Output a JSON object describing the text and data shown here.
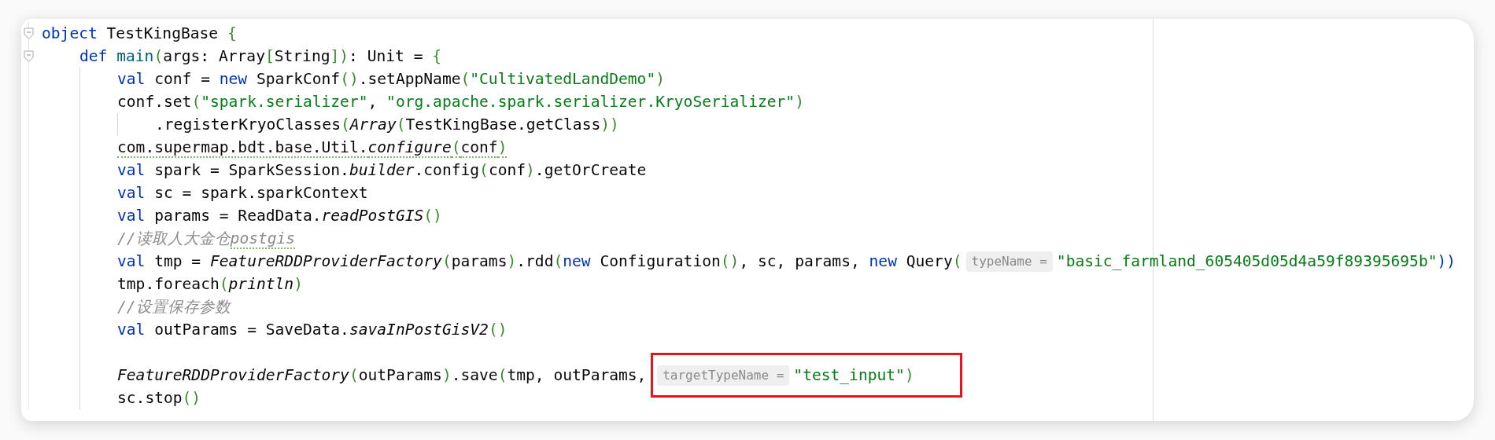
{
  "editor": {
    "lines": [
      {
        "kind": "code",
        "fold_marker": true,
        "tokens": [
          {
            "kind": "kw",
            "text": "object"
          },
          {
            "kind": "plain",
            "text": " TestKingBase "
          },
          {
            "kind": "punct",
            "text": "{"
          }
        ],
        "children": [
          {
            "kind": "code",
            "fold_marker": true,
            "tokens": [
              {
                "kind": "kw",
                "text": "def"
              },
              {
                "kind": "fn",
                "text": " main"
              },
              {
                "kind": "punct",
                "text": "("
              },
              {
                "kind": "plain",
                "text": "args: Array"
              },
              {
                "kind": "punct",
                "text": "["
              },
              {
                "kind": "plain",
                "text": "String"
              },
              {
                "kind": "punct",
                "text": "])"
              },
              {
                "kind": "plain",
                "text": ": Unit = "
              },
              {
                "kind": "punct",
                "text": "{"
              }
            ],
            "children": [
              {
                "kind": "code",
                "tokens": [
                  {
                    "kind": "kw",
                    "text": "val"
                  },
                  {
                    "kind": "plain",
                    "text": " conf = "
                  },
                  {
                    "kind": "kw",
                    "text": "new"
                  },
                  {
                    "kind": "plain",
                    "text": " SparkConf"
                  },
                  {
                    "kind": "punct",
                    "text": "()"
                  },
                  {
                    "kind": "plain",
                    "text": ".setAppName"
                  },
                  {
                    "kind": "punct",
                    "text": "("
                  },
                  {
                    "kind": "str",
                    "text": "\"CultivatedLandDemo\""
                  },
                  {
                    "kind": "punct",
                    "text": ")"
                  }
                ]
              },
              {
                "kind": "code",
                "tokens": [
                  {
                    "kind": "plain",
                    "text": "conf.set"
                  },
                  {
                    "kind": "punct",
                    "text": "("
                  },
                  {
                    "kind": "str",
                    "text": "\"spark.serializer\""
                  },
                  {
                    "kind": "plain",
                    "text": ", "
                  },
                  {
                    "kind": "str",
                    "text": "\"org.apache.spark.serializer.KryoSerializer\""
                  },
                  {
                    "kind": "punct",
                    "text": ")"
                  }
                ],
                "children": [
                  {
                    "kind": "code",
                    "tokens": [
                      {
                        "kind": "plain",
                        "text": ".registerKryoClasses"
                      },
                      {
                        "kind": "punct",
                        "text": "("
                      },
                      {
                        "kind": "italic",
                        "text": "Array"
                      },
                      {
                        "kind": "punct",
                        "text": "("
                      },
                      {
                        "kind": "plain",
                        "text": "TestKingBase.getClass"
                      },
                      {
                        "kind": "punct",
                        "text": "))"
                      }
                    ]
                  }
                ]
              },
              {
                "kind": "code",
                "tokens": [
                  {
                    "kind": "plain",
                    "text": "com.supermap.bdt.base.Util.",
                    "warning": true
                  },
                  {
                    "kind": "italic",
                    "text": "configure",
                    "warning": true
                  },
                  {
                    "kind": "punct",
                    "text": "(",
                    "warning": true
                  },
                  {
                    "kind": "plain",
                    "text": "conf",
                    "warning": true
                  },
                  {
                    "kind": "punct",
                    "text": ")",
                    "warning": true
                  }
                ]
              },
              {
                "kind": "code",
                "tokens": [
                  {
                    "kind": "kw",
                    "text": "val"
                  },
                  {
                    "kind": "plain",
                    "text": " spark = SparkSession."
                  },
                  {
                    "kind": "italic",
                    "text": "builder"
                  },
                  {
                    "kind": "plain",
                    "text": ".config"
                  },
                  {
                    "kind": "punct",
                    "text": "("
                  },
                  {
                    "kind": "plain",
                    "text": "conf"
                  },
                  {
                    "kind": "punct",
                    "text": ")"
                  },
                  {
                    "kind": "plain",
                    "text": ".getOrCreate"
                  }
                ]
              },
              {
                "kind": "code",
                "tokens": [
                  {
                    "kind": "kw",
                    "text": "val"
                  },
                  {
                    "kind": "plain",
                    "text": " sc = spark.sparkContext"
                  }
                ]
              },
              {
                "kind": "code",
                "tokens": [
                  {
                    "kind": "kw",
                    "text": "val"
                  },
                  {
                    "kind": "plain",
                    "text": " params = ReadData."
                  },
                  {
                    "kind": "italic",
                    "text": "readPostGIS"
                  },
                  {
                    "kind": "punct",
                    "text": "()"
                  }
                ]
              },
              {
                "kind": "code",
                "tokens": [
                  {
                    "kind": "comment",
                    "text": "//读取人大金仓"
                  },
                  {
                    "kind": "comment",
                    "text": "postgis",
                    "warning": true
                  }
                ]
              },
              {
                "kind": "code",
                "tokens": [
                  {
                    "kind": "kw",
                    "text": "val"
                  },
                  {
                    "kind": "plain",
                    "text": " tmp = "
                  },
                  {
                    "kind": "italic",
                    "text": "FeatureRDDProviderFactory"
                  },
                  {
                    "kind": "punct",
                    "text": "("
                  },
                  {
                    "kind": "plain",
                    "text": "params"
                  },
                  {
                    "kind": "punct",
                    "text": ")"
                  },
                  {
                    "kind": "plain",
                    "text": ".rdd"
                  },
                  {
                    "kind": "punct",
                    "text": "("
                  },
                  {
                    "kind": "kw",
                    "text": "new"
                  },
                  {
                    "kind": "plain",
                    "text": " Configuration"
                  },
                  {
                    "kind": "punct",
                    "text": "()"
                  },
                  {
                    "kind": "plain",
                    "text": ", sc, params, "
                  },
                  {
                    "kind": "kw",
                    "text": "new"
                  },
                  {
                    "kind": "plain",
                    "text": " Query"
                  },
                  {
                    "kind": "punct",
                    "text": "("
                  },
                  {
                    "kind": "hint",
                    "text": "typeName ="
                  },
                  {
                    "kind": "str",
                    "text": "\"basic_farmland_605405d05d4a59f89395695b\""
                  },
                  {
                    "kind": "kwp",
                    "text": "))"
                  }
                ]
              },
              {
                "kind": "code",
                "tokens": [
                  {
                    "kind": "plain",
                    "text": "tmp.foreach"
                  },
                  {
                    "kind": "punct",
                    "text": "("
                  },
                  {
                    "kind": "italic",
                    "text": "println"
                  },
                  {
                    "kind": "punct",
                    "text": ")"
                  }
                ]
              },
              {
                "kind": "code",
                "tokens": [
                  {
                    "kind": "comment",
                    "text": "//设置保存参数"
                  }
                ]
              },
              {
                "kind": "code",
                "tokens": [
                  {
                    "kind": "kw",
                    "text": "val"
                  },
                  {
                    "kind": "plain",
                    "text": " outParams = SaveData."
                  },
                  {
                    "kind": "italic",
                    "text": "savaInPostGisV2"
                  },
                  {
                    "kind": "punct",
                    "text": "()"
                  }
                ]
              },
              {
                "kind": "blank"
              },
              {
                "kind": "code",
                "tokens": [
                  {
                    "kind": "italic",
                    "text": "FeatureRDDProviderFactory"
                  },
                  {
                    "kind": "punct",
                    "text": "("
                  },
                  {
                    "kind": "plain",
                    "text": "outParams"
                  },
                  {
                    "kind": "punct",
                    "text": ")"
                  },
                  {
                    "kind": "plain",
                    "text": ".save"
                  },
                  {
                    "kind": "punct",
                    "text": "("
                  },
                  {
                    "kind": "plain",
                    "text": "tmp, outParams, "
                  },
                  {
                    "kind": "hint",
                    "text": "targetTypeName =",
                    "boxed": true
                  },
                  {
                    "kind": "str",
                    "text": "\"test_input\"",
                    "boxed": true
                  },
                  {
                    "kind": "punct",
                    "text": ")",
                    "boxed": true
                  }
                ]
              },
              {
                "kind": "code",
                "tokens": [
                  {
                    "kind": "plain",
                    "text": "sc.stop"
                  },
                  {
                    "kind": "punct",
                    "text": "()"
                  }
                ]
              }
            ]
          }
        ]
      }
    ]
  }
}
